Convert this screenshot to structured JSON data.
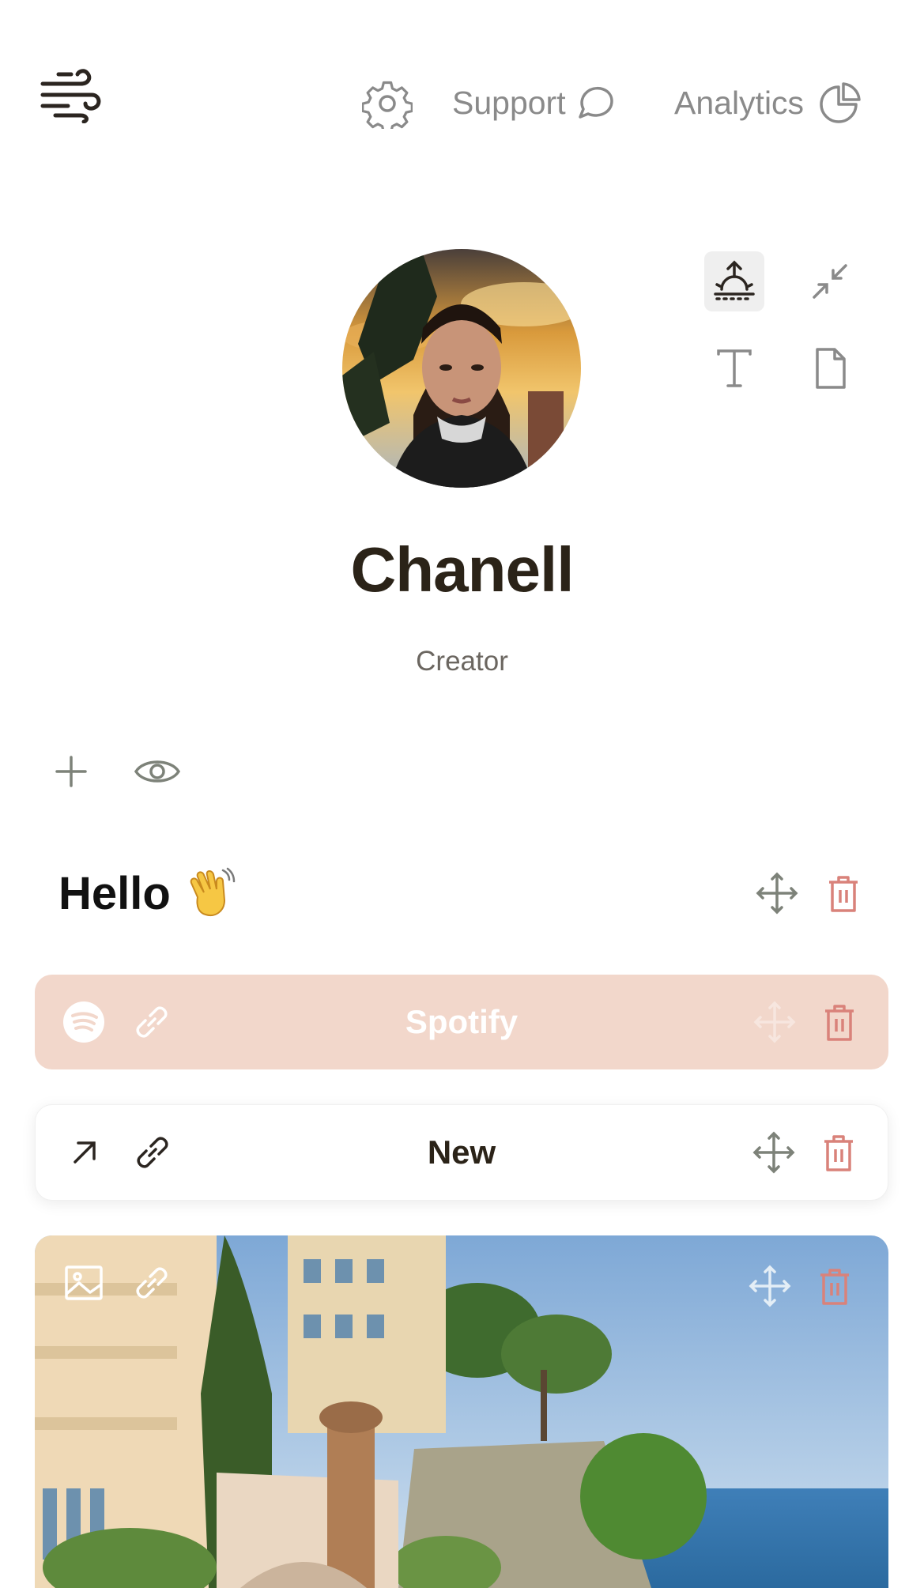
{
  "header": {
    "support_label": "Support",
    "analytics_label": "Analytics",
    "icons": [
      "wind-logo-icon",
      "gear-icon",
      "chat-bubble-icon",
      "pie-chart-icon"
    ]
  },
  "profile": {
    "name": "Chanell",
    "role": "Creator"
  },
  "toolbar": {
    "icons": [
      "sunrise-icon",
      "collapse-icon",
      "text-icon",
      "file-icon"
    ],
    "active": "sunrise-icon"
  },
  "actions": {
    "icons": [
      "plus-icon",
      "eye-icon"
    ]
  },
  "blocks": {
    "hello": {
      "text": "Hello",
      "emoji": "waving-hand-icon"
    },
    "spotify": {
      "label": "Spotify",
      "icons": [
        "spotify-icon",
        "link-icon"
      ]
    },
    "new_link": {
      "label": "New",
      "icons": [
        "arrow-up-right-icon",
        "link-icon"
      ]
    },
    "image": {
      "icons": [
        "image-icon",
        "link-icon"
      ]
    }
  },
  "colors": {
    "accent_peach": "#f2d7cb",
    "delete_red": "#d9827a",
    "move_gray": "#7d8279",
    "text_dark": "#2b2318"
  }
}
